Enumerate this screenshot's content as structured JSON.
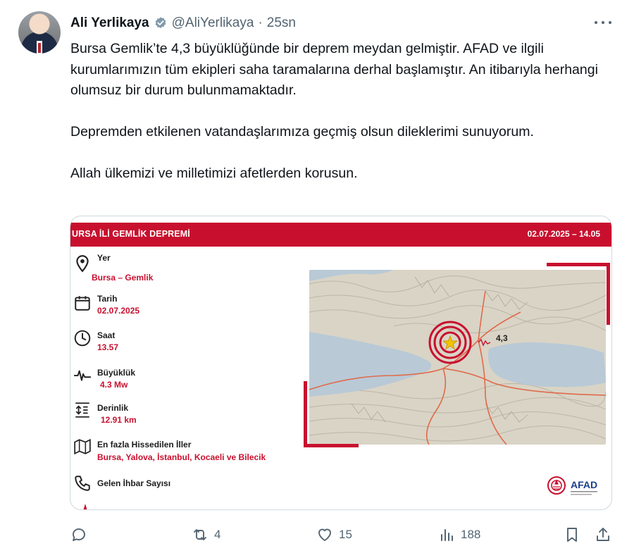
{
  "author": {
    "name": "Ali Yerlikaya",
    "handle": "@AliYerlikaya",
    "separator": "·",
    "time": "25sn"
  },
  "tweet": {
    "paragraph1": "Bursa Gemlik’te 4,3 büyüklüğünde bir deprem meydan gelmiştir. AFAD ve ilgili kurumlarımızın tüm ekipleri saha taramalarına derhal başlamıştır. An itibarıyla herhangi olumsuz bir durum bulunmamaktadır.",
    "paragraph2": "Depremden etkilenen vatandaşlarımıza geçmiş olsun dileklerimi sunuyorum.",
    "paragraph3": "Allah ülkemizi ve milletimizi afetlerden korusun."
  },
  "card": {
    "title": "URSA İLİ GEMLİK DEPREMİ",
    "datetime": "02.07.2025 – 14.05",
    "rows": [
      {
        "label": "Yer",
        "value": "Bursa – Gemlik",
        "icon": "location-pin-icon"
      },
      {
        "label": "Tarih",
        "value": "02.07.2025",
        "icon": "calendar-icon"
      },
      {
        "label": "Saat",
        "value": "13.57",
        "icon": "clock-icon"
      },
      {
        "label": "Büyüklük",
        "value": "4.3 Mw",
        "icon": "seismograph-icon"
      },
      {
        "label": "Derinlik",
        "value": "12.91 km",
        "icon": "depth-icon"
      },
      {
        "label": "En fazla Hissedilen İller",
        "value": "Bursa, Yalova, İstanbul, Kocaeli ve Bilecik",
        "icon": "map-icon"
      },
      {
        "label": "Gelen İhbar Sayısı",
        "value": "",
        "icon": "phone-icon"
      }
    ],
    "map_magnitude_label": "4,3",
    "logo_text": "AFAD",
    "accent_color": "#c8102e"
  },
  "actions": {
    "replies": "",
    "reposts": "4",
    "likes": "15",
    "views": "188"
  },
  "colors": {
    "text": "#0f1419",
    "muted": "#536471",
    "verified": "#829aab"
  }
}
